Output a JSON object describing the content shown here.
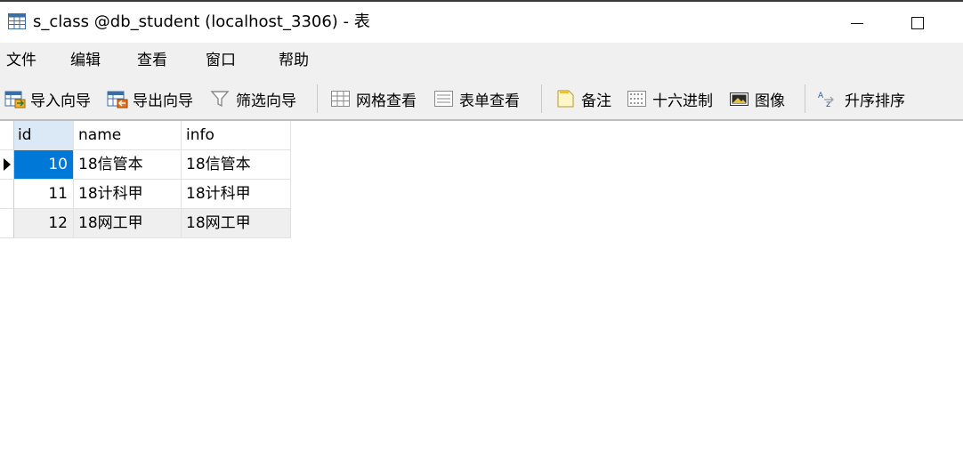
{
  "window": {
    "title": "s_class @db_student (localhost_3306) - 表",
    "minimize_glyph": "",
    "maximize_glyph": ""
  },
  "menu": {
    "items": [
      "文件",
      "编辑",
      "查看",
      "窗口",
      "帮助"
    ]
  },
  "toolbar": {
    "import_wizard": "导入向导",
    "export_wizard": "导出向导",
    "filter_wizard": "筛选向导",
    "grid_view": "网格查看",
    "form_view": "表单查看",
    "memo": "备注",
    "hex": "十六进制",
    "image": "图像",
    "sort_asc": "升序排序"
  },
  "table": {
    "columns": [
      "id",
      "name",
      "info"
    ],
    "rows": [
      {
        "id": "10",
        "name": "18信管本",
        "info": "18信管本"
      },
      {
        "id": "11",
        "name": "18计科甲",
        "info": "18计科甲"
      },
      {
        "id": "12",
        "name": "18网工甲",
        "info": "18网工甲"
      }
    ]
  },
  "colors": {
    "selection": "#0078d7",
    "header_active": "#dbe9f7",
    "chrome": "#f0f0f0"
  }
}
